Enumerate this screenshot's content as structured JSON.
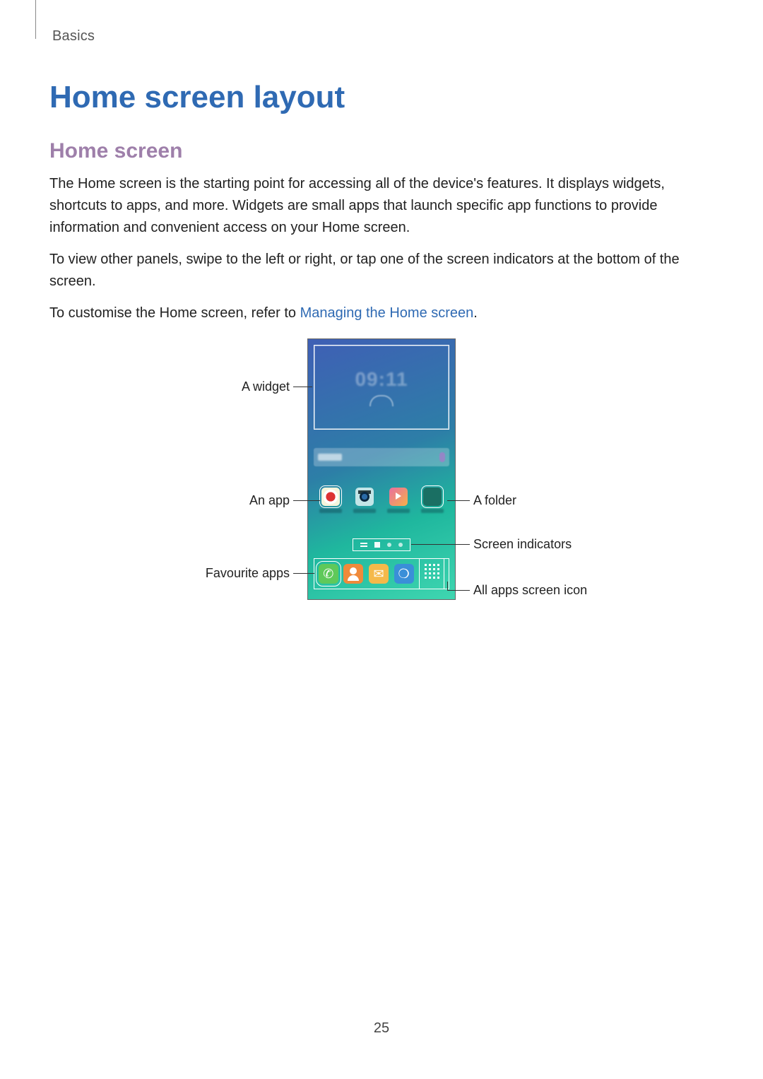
{
  "breadcrumb": "Basics",
  "title": "Home screen layout",
  "subtitle": "Home screen",
  "para1": "The Home screen is the starting point for accessing all of the device's features. It displays widgets, shortcuts to apps, and more. Widgets are small apps that launch specific app functions to provide information and convenient access on your Home screen.",
  "para2": "To view other panels, swipe to the left or right, or tap one of the screen indicators at the bottom of the screen.",
  "para3_pre": "To customise the Home screen, refer to ",
  "para3_link": "Managing the Home screen",
  "para3_post": ".",
  "callouts": {
    "widget": "A widget",
    "app": "An app",
    "fav": "Favourite apps",
    "folder": "A folder",
    "indicators": "Screen indicators",
    "allapps": "All apps screen icon"
  },
  "widget_time": "09:11",
  "page_number": "25"
}
